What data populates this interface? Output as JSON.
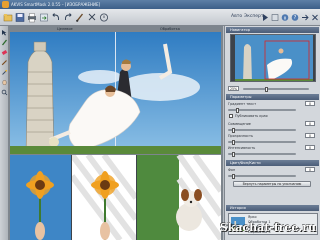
{
  "window": {
    "title": "AKVIS SmartMask 2.0.55 – [ИЗОБРАЖЕНИЕ]"
  },
  "toolbar": {
    "buttons": [
      "open-file-icon",
      "save-file-icon",
      "print-icon",
      "export-icon",
      "undo-icon",
      "redo-icon",
      "brush-settings-icon",
      "info-icon",
      "help-icon"
    ],
    "mode_auto": "Авто",
    "mode_expert": "Эксперт",
    "right_buttons": [
      "run-icon",
      "settings-icon",
      "about-icon",
      "help-icon",
      "arrow-icon",
      "close-icon"
    ]
  },
  "tools": [
    "select-tool-icon",
    "brush-tool-icon",
    "eraser-tool-icon",
    "pencil-tool-icon",
    "magic-tool-icon",
    "hand-tool-icon",
    "zoom-tool-icon"
  ],
  "canvas": {
    "tab_before": "Целевое",
    "tab_after": "Обработка"
  },
  "panel": {
    "navigator_title": "Навигатор",
    "zoom_value": "25%",
    "params_title": "Параметры",
    "params_label": "Градиентная",
    "setting_1_label": "Градиент текст",
    "setting_1_value": "0",
    "checkbox_label": "Публиковать края",
    "setting_2_label": "Совмещение",
    "setting_2_value": "0",
    "setting_3_label": "Прозрачность",
    "setting_3_value": "0",
    "setting_4_label": "Интенсивность",
    "setting_4_value": "0",
    "section_2_title": "Цвет/Фон/Кисти",
    "color_label": "Фон",
    "color_value": "0",
    "reset_button": "Вернуть параметры по умолчанию",
    "history_title": "История",
    "history_items": [
      "Ярко",
      "Обработка 1",
      "Обработка 2",
      "Обработка 3"
    ]
  },
  "watermark": "Skachat-free.ru",
  "colors": {
    "accent": "#4b5d78",
    "sky": "#4a90c8",
    "grass": "#5a8a3a"
  }
}
